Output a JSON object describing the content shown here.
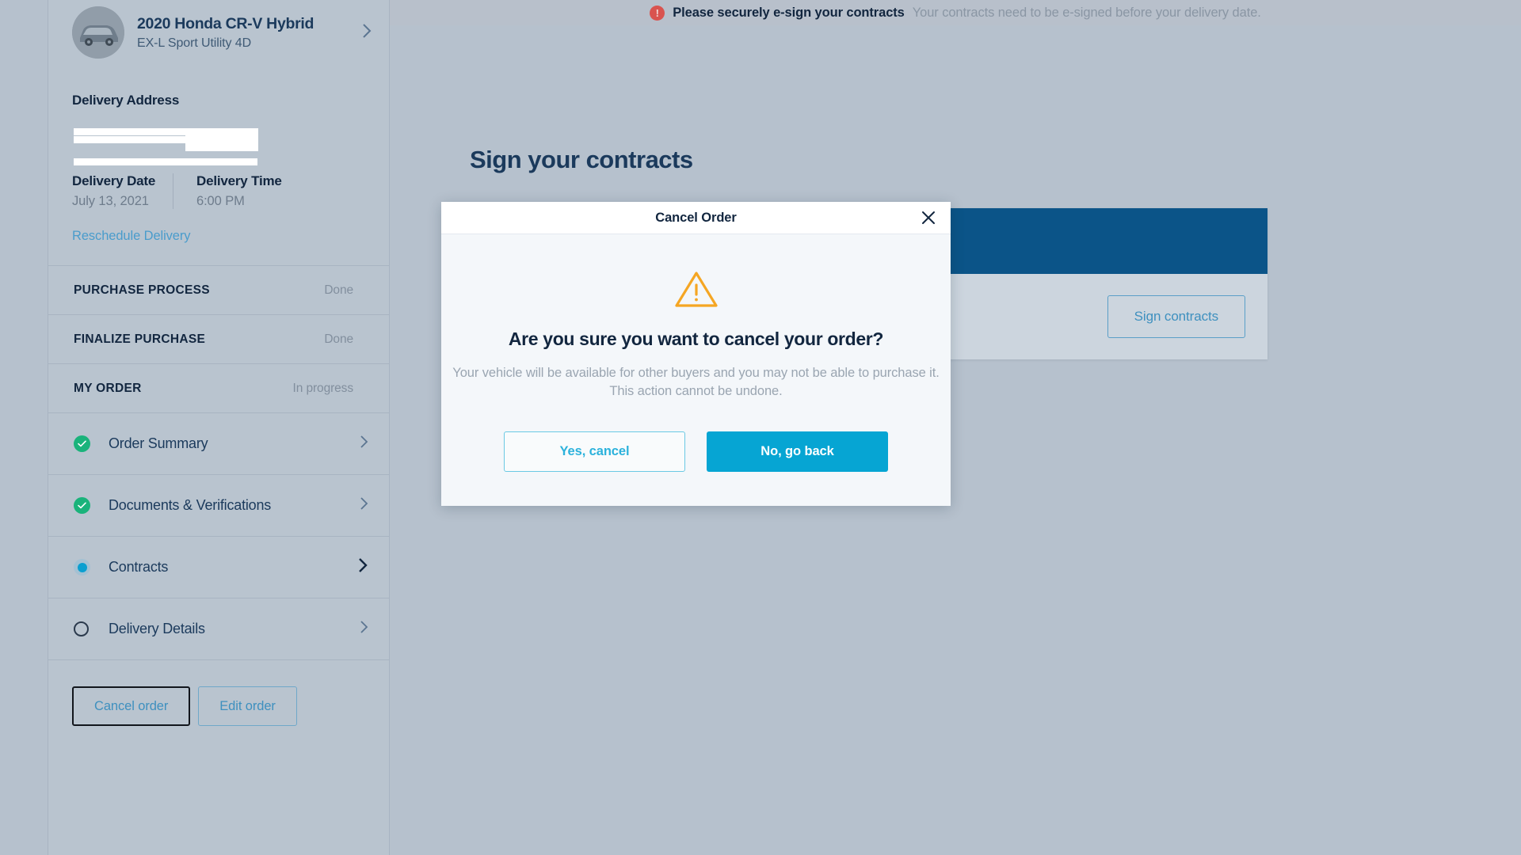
{
  "alert": {
    "icon": "alert-circle-icon",
    "strong": "Please securely e-sign your contracts",
    "message": "Your contracts need to be e-signed before your delivery date."
  },
  "sidebar": {
    "vehicle": {
      "title": "2020 Honda CR-V Hybrid",
      "trim": "EX-L Sport Utility 4D"
    },
    "delivery_address": {
      "label": "Delivery Address",
      "redacted": true
    },
    "delivery_date": {
      "label": "Delivery Date",
      "value": "July 13, 2021"
    },
    "delivery_time": {
      "label": "Delivery Time",
      "value": "6:00 PM"
    },
    "reschedule_link": "Reschedule Delivery",
    "sections": [
      {
        "title": "PURCHASE PROCESS",
        "status": "Done"
      },
      {
        "title": "FINALIZE PURCHASE",
        "status": "Done"
      },
      {
        "title": "MY ORDER",
        "status": "In progress"
      }
    ],
    "checklist": [
      {
        "label": "Order Summary",
        "state": "done"
      },
      {
        "label": "Documents & Verifications",
        "state": "done"
      },
      {
        "label": "Contracts",
        "state": "active"
      },
      {
        "label": "Delivery Details",
        "state": "todo"
      }
    ],
    "buttons": {
      "cancel_order": "Cancel order",
      "edit_order": "Edit order"
    }
  },
  "main": {
    "page_title": "Sign your contracts",
    "sign_contracts_button": "Sign contracts"
  },
  "modal": {
    "title": "Cancel Order",
    "close_icon": "close-icon",
    "warning_icon": "warning-triangle-icon",
    "question": "Are you sure you want to cancel your order?",
    "body": "Your vehicle will be available for other buyers and you may not be able to purchase it. This action cannot be undone.",
    "confirm_label": "Yes, cancel",
    "dismiss_label": "No, go back"
  },
  "colors": {
    "page_bg": "#b6c1cd",
    "sidebar_bg": "#b9c4cf",
    "navy": "#12263f",
    "link_blue": "#3e90bf",
    "cyan": "#06a5d3",
    "green": "#1ab37b",
    "warning_orange": "#f5a623",
    "panel_header_blue": "#0b5488",
    "alert_red": "#d9534f"
  }
}
